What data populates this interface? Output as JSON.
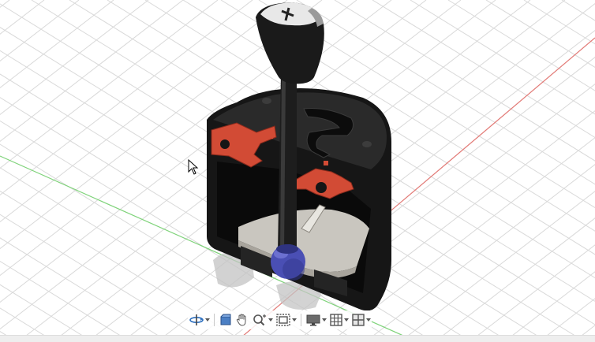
{
  "viewport": {
    "grid_color": "#d9d9d9",
    "x_axis_color": "#e27a76",
    "z_axis_color": "#7fd37a",
    "model_body_color": "#141414",
    "section_color": "#d24b35",
    "ball_color": "#4a4fb4",
    "platform_color": "#c9c6bf"
  },
  "toolbar": {
    "tools": [
      {
        "icon": "orbit-icon",
        "has_dropdown": true
      },
      {
        "icon": "look-at-icon",
        "has_dropdown": false
      },
      {
        "icon": "pan-hand-icon",
        "has_dropdown": false
      },
      {
        "icon": "zoom-icon",
        "has_dropdown": true
      },
      {
        "icon": "fit-window-icon",
        "has_dropdown": true
      },
      {
        "icon": "display-settings-icon",
        "has_dropdown": true
      },
      {
        "icon": "grid-settings-icon",
        "has_dropdown": true
      },
      {
        "icon": "viewports-icon",
        "has_dropdown": true
      }
    ]
  }
}
